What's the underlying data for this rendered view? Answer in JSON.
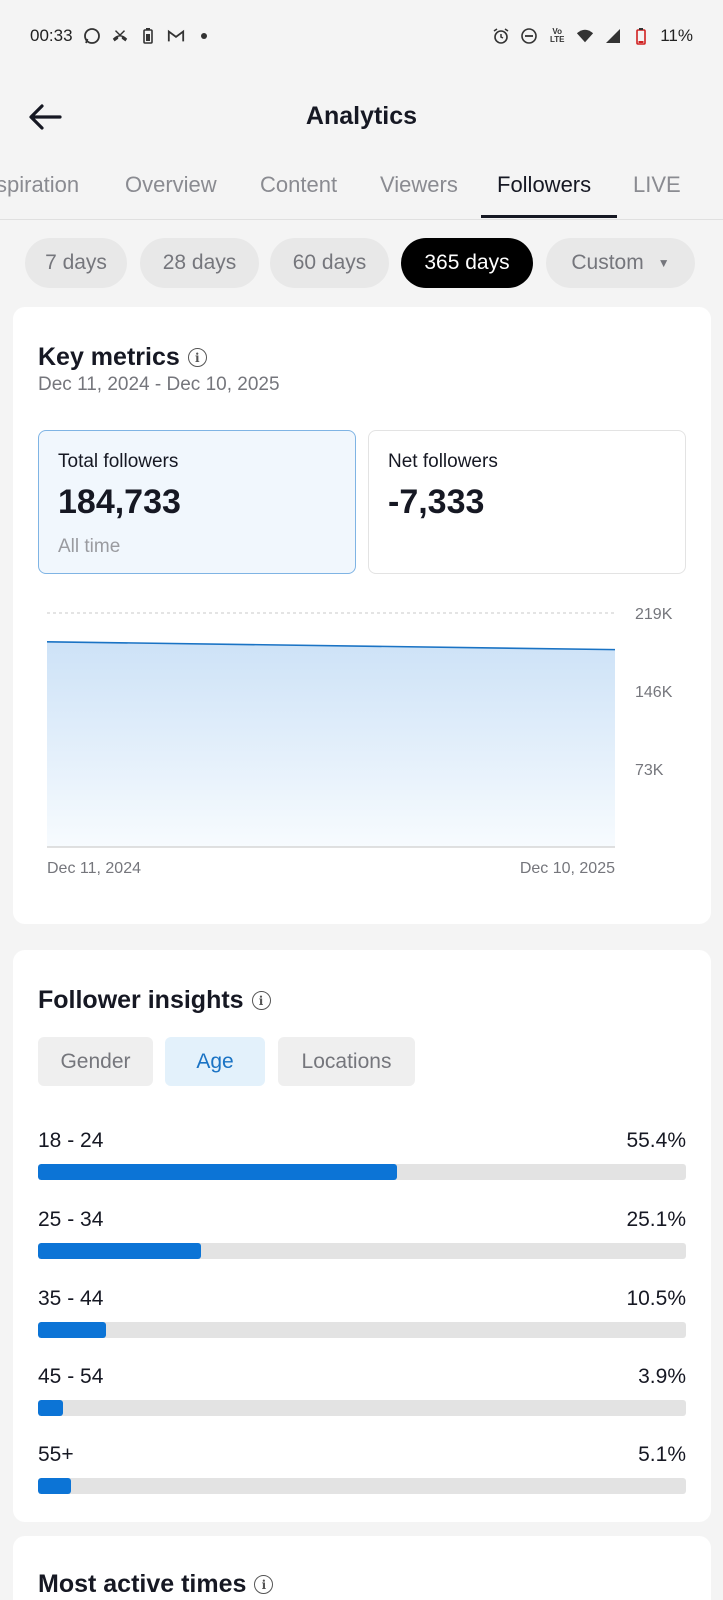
{
  "status_bar": {
    "time": "00:33",
    "battery": "11%",
    "left_icons": [
      "whatsapp-icon",
      "missed-call-icon",
      "battery-saver-icon",
      "gmail-icon",
      "dot-icon"
    ],
    "right_icons": [
      "alarm-icon",
      "do-not-disturb-icon",
      "volte-icon",
      "wifi-icon",
      "signal-icon",
      "battery-icon"
    ],
    "volte_text": "Vo LTE"
  },
  "header": {
    "title": "Analytics"
  },
  "tabs": [
    {
      "label": "spiration",
      "active": false
    },
    {
      "label": "Overview",
      "active": false
    },
    {
      "label": "Content",
      "active": false
    },
    {
      "label": "Viewers",
      "active": false
    },
    {
      "label": "Followers",
      "active": true
    },
    {
      "label": "LIVE",
      "active": false
    }
  ],
  "ranges": [
    {
      "label": "7 days",
      "active": false
    },
    {
      "label": "28 days",
      "active": false
    },
    {
      "label": "60 days",
      "active": false
    },
    {
      "label": "365 days",
      "active": true
    },
    {
      "label": "Custom",
      "active": false
    }
  ],
  "key_metrics": {
    "title": "Key metrics",
    "date_range": "Dec 11, 2024 - Dec 10, 2025",
    "total_followers": {
      "label": "Total followers",
      "value": "184,733",
      "sub": "All time"
    },
    "net_followers": {
      "label": "Net followers",
      "value": "-7,333"
    }
  },
  "chart_data": {
    "type": "area",
    "x": [
      "Dec 11, 2024",
      "Dec 10, 2025"
    ],
    "values": [
      192066,
      184733
    ],
    "y_ticks": [
      "219K",
      "146K",
      "73K"
    ],
    "y_tick_values": [
      219000,
      146000,
      73000
    ],
    "ylim": [
      0,
      219000
    ],
    "x_labels": [
      "Dec 11, 2024",
      "Dec 10, 2025"
    ],
    "grid": true,
    "line_color": "#1a73c4",
    "fill_color": "#cfe3f8"
  },
  "insights": {
    "title": "Follower insights",
    "segments": [
      {
        "label": "Gender",
        "active": false
      },
      {
        "label": "Age",
        "active": true
      },
      {
        "label": "Locations",
        "active": false
      }
    ],
    "ages": [
      {
        "label": "18 - 24",
        "pct": "55.4%",
        "value": 55.4
      },
      {
        "label": "25 - 34",
        "pct": "25.1%",
        "value": 25.1
      },
      {
        "label": "35 - 44",
        "pct": "10.5%",
        "value": 10.5
      },
      {
        "label": "45 - 54",
        "pct": "3.9%",
        "value": 3.9
      },
      {
        "label": "55+",
        "pct": "5.1%",
        "value": 5.1
      }
    ]
  },
  "most_active": {
    "title": "Most active times"
  },
  "colors": {
    "accent": "#0c74d6",
    "active_chip": "#000000",
    "background": "#f4f4f4"
  }
}
